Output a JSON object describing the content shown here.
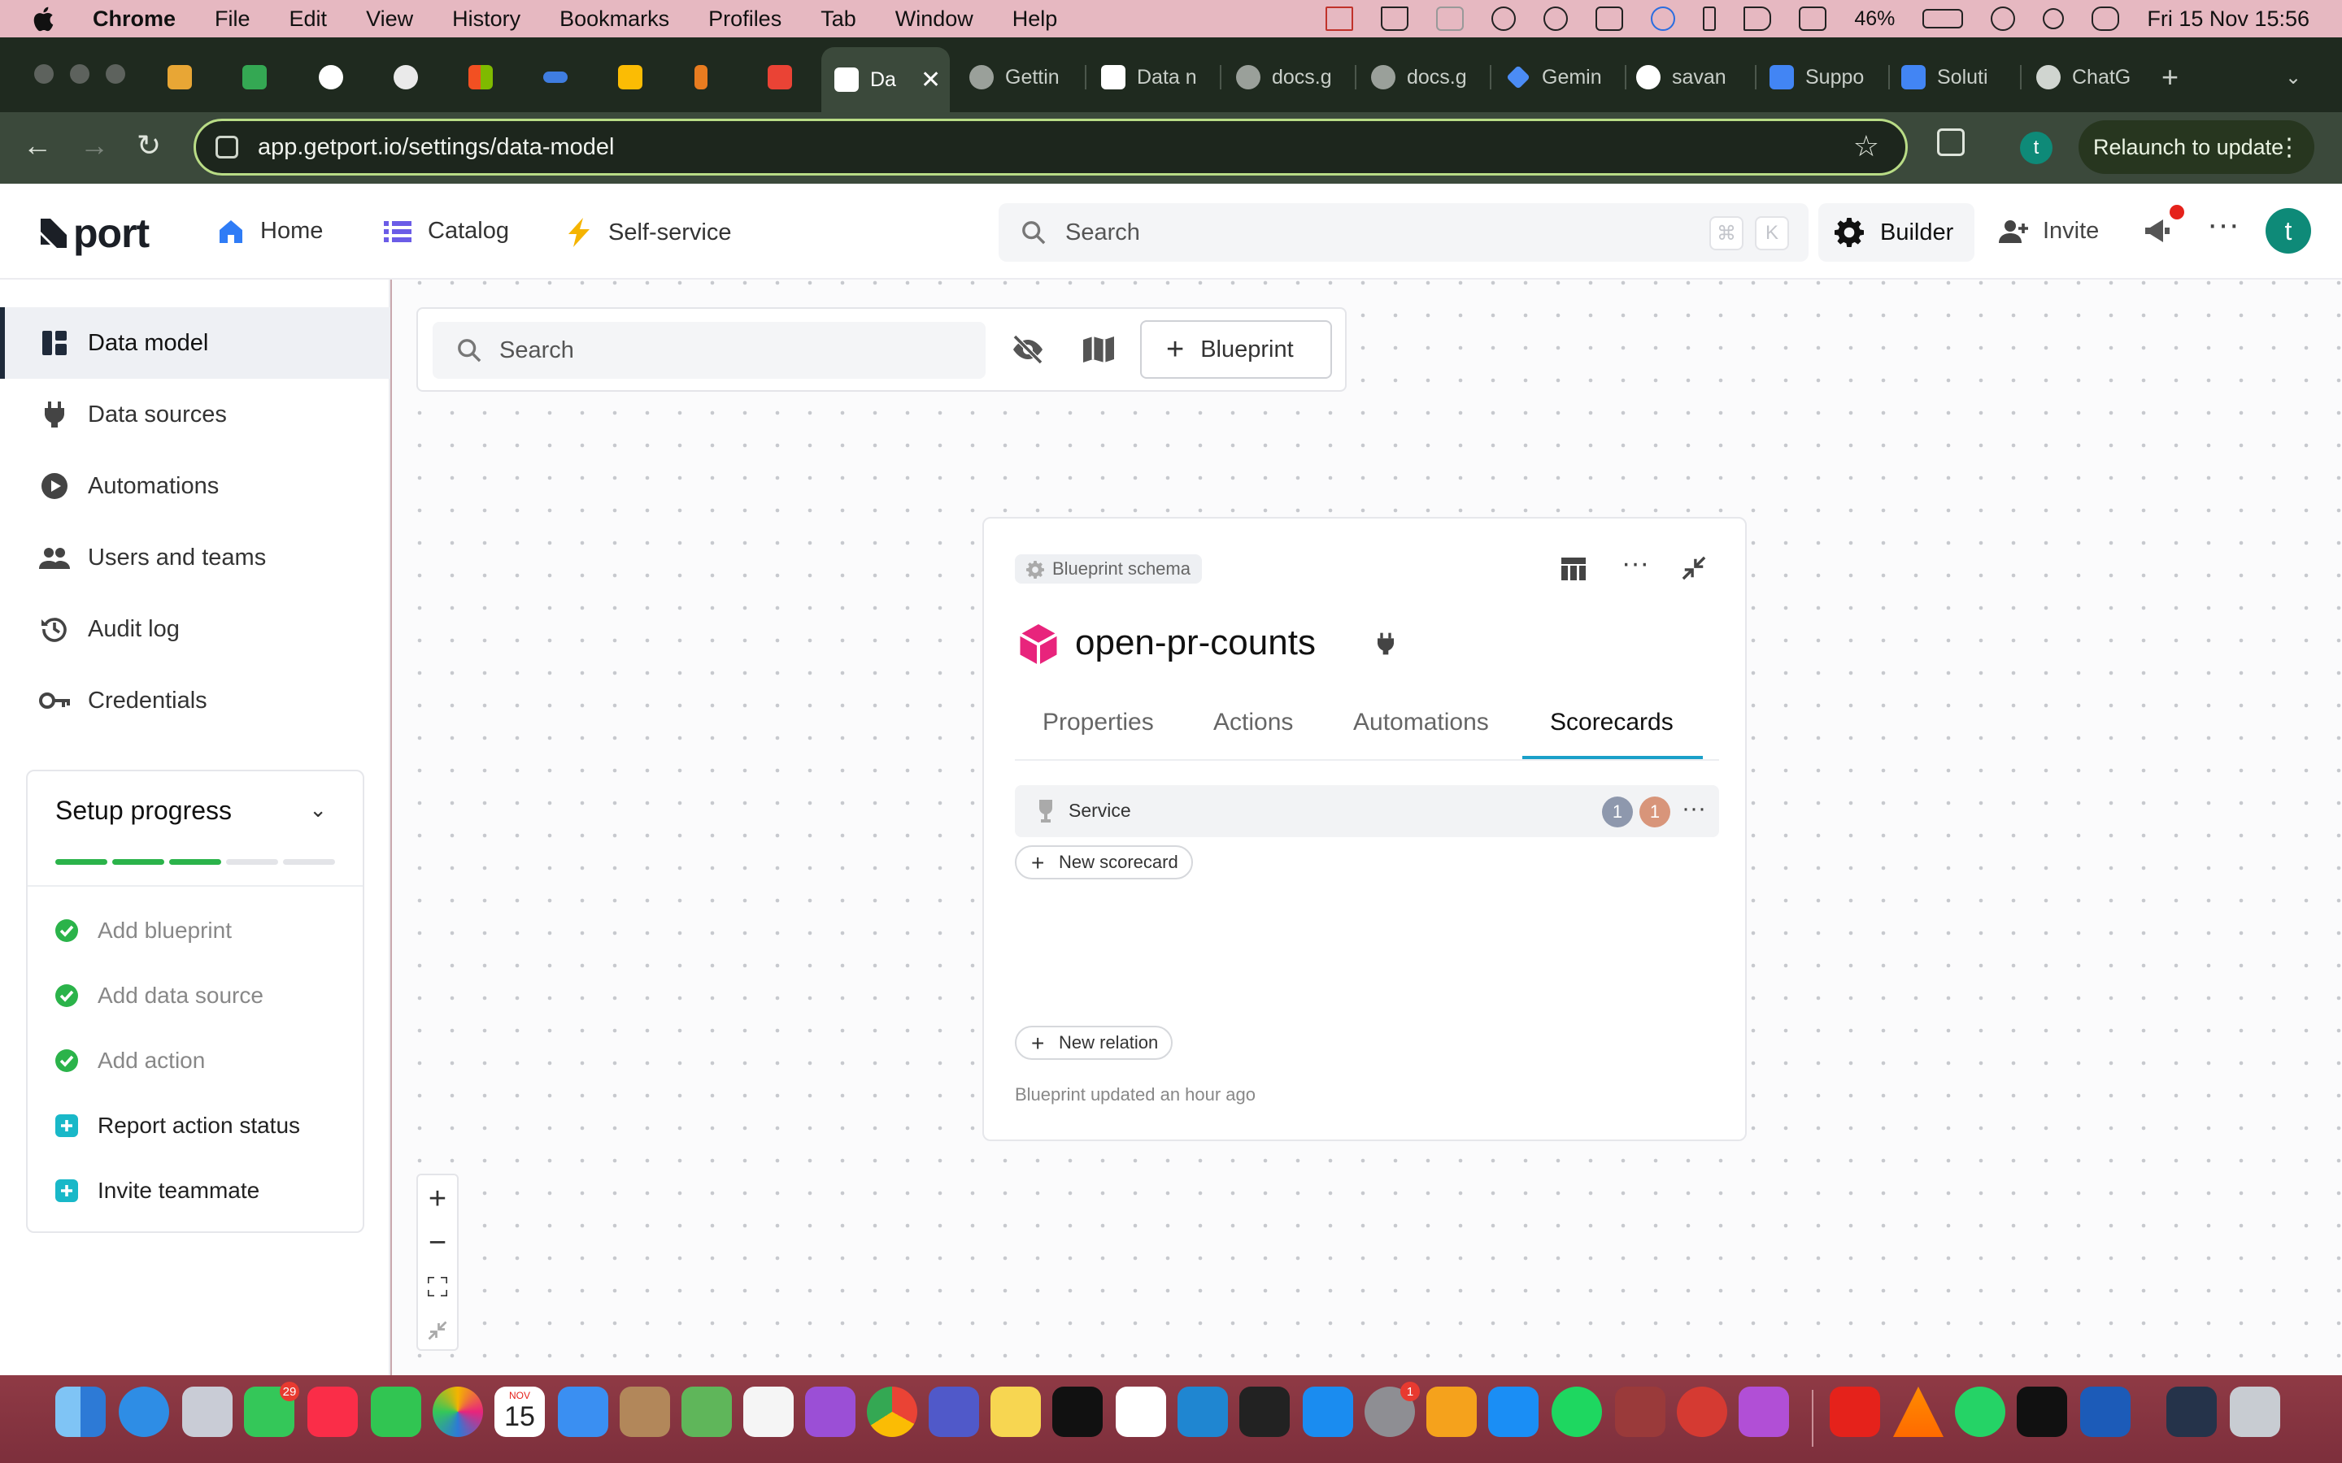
{
  "menubar": {
    "app": "Chrome",
    "items": [
      "File",
      "Edit",
      "View",
      "History",
      "Bookmarks",
      "Profiles",
      "Tab",
      "Window",
      "Help"
    ],
    "battery": "46%",
    "datetime": "Fri 15 Nov  15:56"
  },
  "browser": {
    "active_tab": "Da",
    "tabs": [
      "Gettin",
      "Data n",
      "docs.g",
      "docs.g",
      "Gemin",
      "savan",
      "Suppo",
      "Soluti",
      "ChatG"
    ],
    "url": "app.getport.io/settings/data-model",
    "profile_initial": "t",
    "relaunch_label": "Relaunch to update"
  },
  "header": {
    "logo": "port",
    "nav": [
      {
        "label": "Home"
      },
      {
        "label": "Catalog"
      },
      {
        "label": "Self-service"
      }
    ],
    "search_placeholder": "Search",
    "kbd_cmd": "⌘",
    "kbd_key": "K",
    "builder_label": "Builder",
    "invite_label": "Invite",
    "avatar_initial": "t"
  },
  "sidebar": {
    "items": [
      {
        "label": "Data model",
        "icon": "dashboard-icon"
      },
      {
        "label": "Data sources",
        "icon": "plug-icon"
      },
      {
        "label": "Automations",
        "icon": "play-circle-icon"
      },
      {
        "label": "Users and teams",
        "icon": "people-icon"
      },
      {
        "label": "Audit log",
        "icon": "history-icon"
      },
      {
        "label": "Credentials",
        "icon": "key-icon"
      }
    ],
    "setup": {
      "title": "Setup progress",
      "progress_done": 3,
      "progress_total": 5,
      "steps": [
        {
          "label": "Add blueprint",
          "done": true
        },
        {
          "label": "Add data source",
          "done": true
        },
        {
          "label": "Add action",
          "done": true
        },
        {
          "label": "Report action status",
          "done": false
        },
        {
          "label": "Invite teammate",
          "done": false
        }
      ]
    }
  },
  "canvas": {
    "search_placeholder": "Search",
    "blueprint_button": "Blueprint",
    "card": {
      "chip": "Blueprint schema",
      "name": "open-pr-counts",
      "tabs": [
        "Properties",
        "Actions",
        "Automations",
        "Scorecards"
      ],
      "active_tab": "Scorecards",
      "scorecard": {
        "name": "Service",
        "badge_a": "1",
        "badge_b": "1"
      },
      "new_scorecard": "New scorecard",
      "new_relation": "New relation",
      "updated": "Blueprint updated an hour ago"
    }
  },
  "dock": {
    "messages_badge": "29",
    "calendar_month": "NOV",
    "calendar_day": "15",
    "settings_badge": "1"
  },
  "colors": {
    "accent_tab": "#1aa0c9",
    "progress_done": "#2bb34a",
    "avatar": "#0e8a78",
    "blueprint_icon": "#e8247c"
  }
}
